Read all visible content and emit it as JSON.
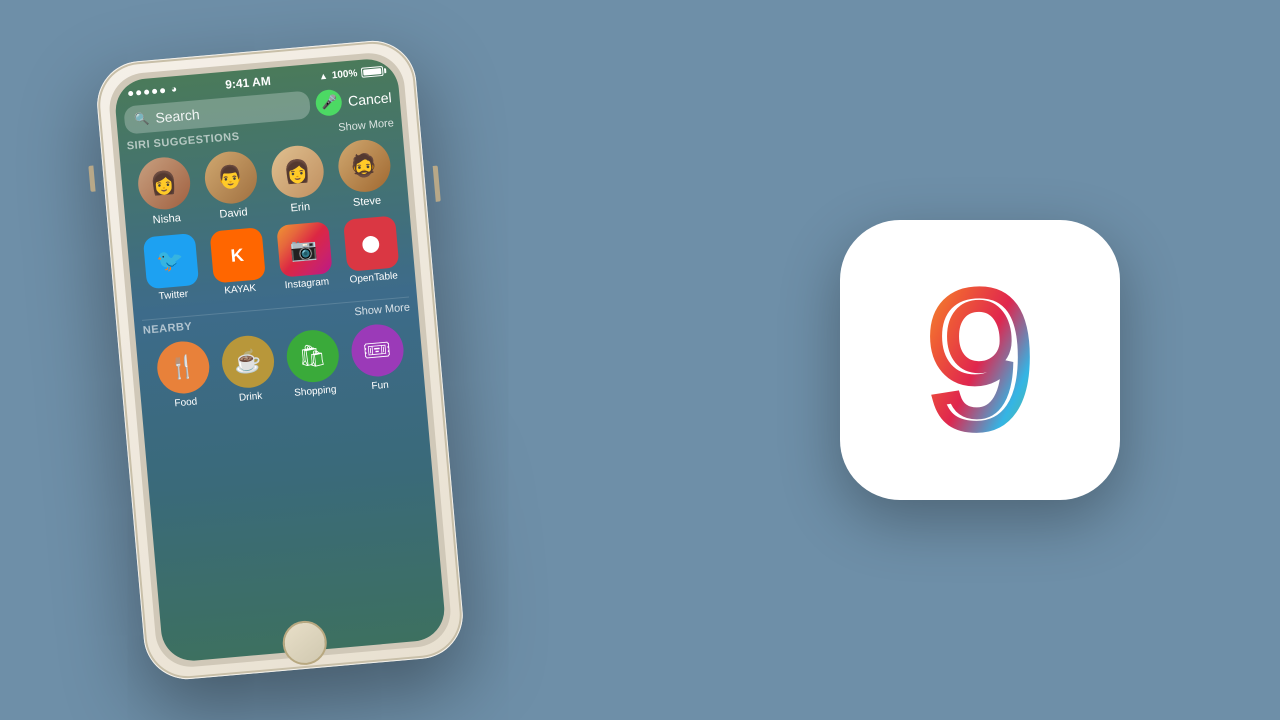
{
  "background_color": "#6e8fa8",
  "iphone": {
    "status_bar": {
      "dots": 5,
      "wifi": "wifi",
      "time": "9:41 AM",
      "location": "▲",
      "battery": "100%"
    },
    "search": {
      "placeholder": "Search",
      "cancel_label": "Cancel",
      "mic_label": "mic"
    },
    "siri_section": {
      "title": "SIRI SUGGESTIONS",
      "show_more": "Show More",
      "contacts": [
        {
          "name": "Nisha",
          "emoji": "👩"
        },
        {
          "name": "David",
          "emoji": "👨"
        },
        {
          "name": "Erin",
          "emoji": "👩"
        },
        {
          "name": "Steve",
          "emoji": "👨"
        }
      ],
      "apps": [
        {
          "name": "Twitter",
          "class": "app-twitter",
          "symbol": "🐦"
        },
        {
          "name": "KAYAK",
          "class": "app-kayak",
          "symbol": "K"
        },
        {
          "name": "Instagram",
          "class": "app-instagram",
          "symbol": "📷"
        },
        {
          "name": "OpenTable",
          "class": "app-opentable",
          "symbol": "⬤"
        }
      ]
    },
    "nearby_section": {
      "title": "NEARBY",
      "show_more": "Show More",
      "items": [
        {
          "name": "Food",
          "class": "nearby-food",
          "symbol": "🍴"
        },
        {
          "name": "Drink",
          "class": "nearby-drink",
          "symbol": "☕"
        },
        {
          "name": "Shopping",
          "class": "nearby-shopping",
          "symbol": "🛍"
        },
        {
          "name": "Fun",
          "class": "nearby-fun",
          "symbol": "🎟"
        }
      ]
    }
  },
  "ios9_logo": {
    "digit": "9"
  }
}
